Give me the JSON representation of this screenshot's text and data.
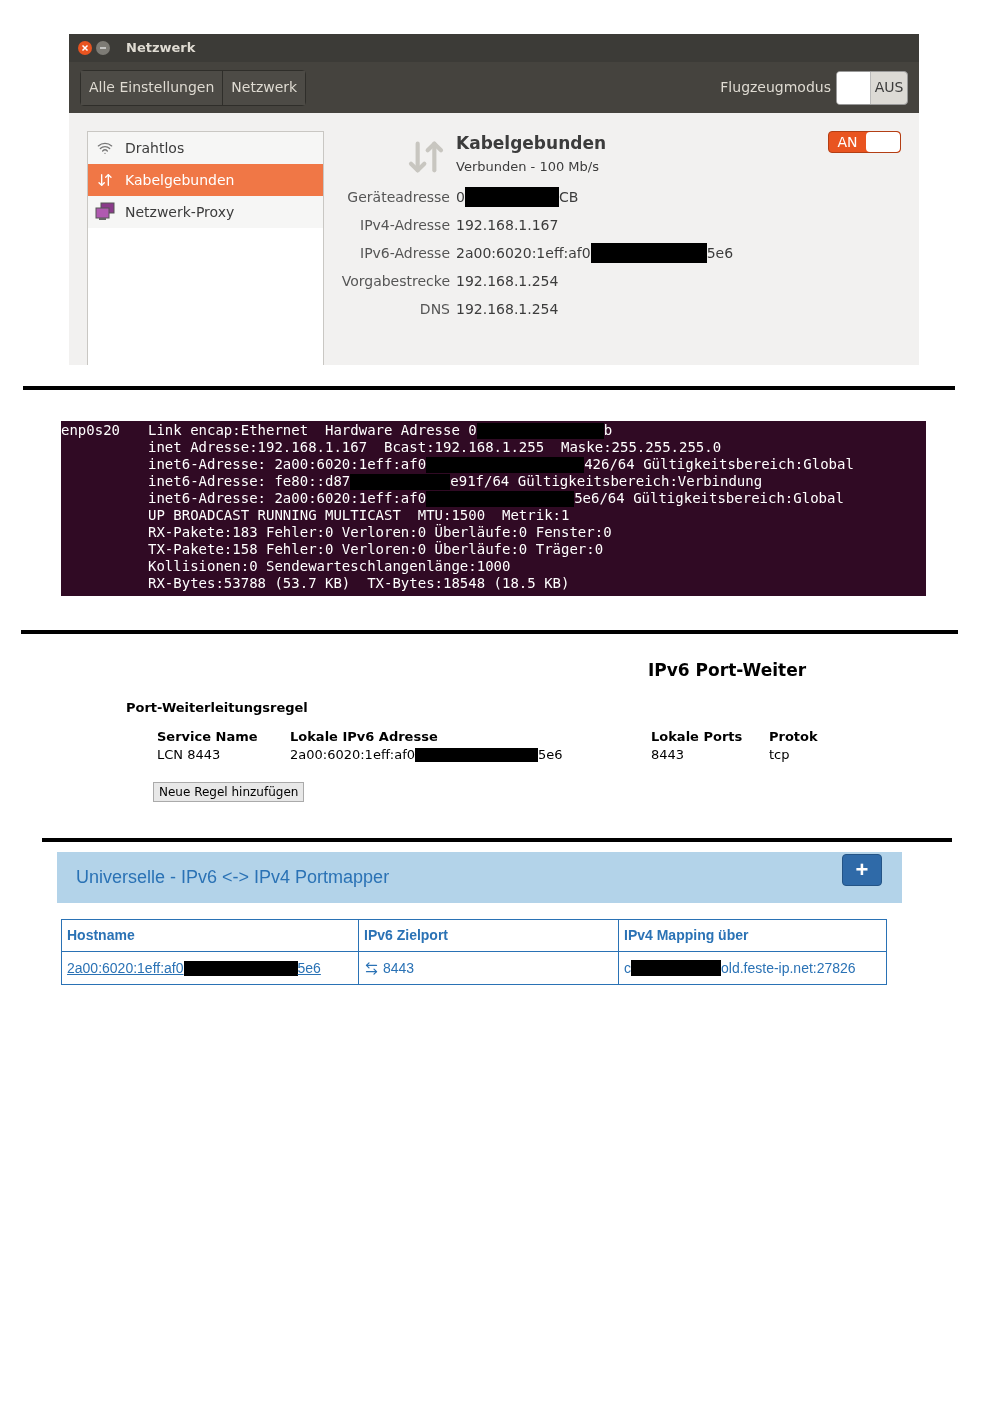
{
  "network_window": {
    "title": "Netzwerk",
    "breadcrumbs": [
      {
        "label": "Alle Einstellungen"
      },
      {
        "label": "Netzwerk"
      }
    ],
    "airplane_mode": {
      "label": "Flugzeugmodus",
      "state_text": "AUS",
      "on": false
    },
    "sidebar": {
      "items": [
        {
          "label": "Drahtlos",
          "kind": "wifi",
          "selected": false
        },
        {
          "label": "Kabelgebunden",
          "kind": "wired",
          "selected": true
        },
        {
          "label": "Netzwerk-Proxy",
          "kind": "proxy",
          "selected": false
        }
      ]
    },
    "connection": {
      "title": "Kabelgebunden",
      "status": "Verbunden - 100 Mb/s",
      "switch": {
        "state_text": "AN",
        "on": true
      },
      "details": [
        {
          "label": "Geräteadresse",
          "parts": [
            "0",
            "CB"
          ]
        },
        {
          "label": "IPv4-Adresse",
          "parts": [
            "192.168.1.167"
          ]
        },
        {
          "label": "IPv6-Adresse",
          "parts": [
            "2a00:6020:1eff:af0",
            "5e6"
          ]
        },
        {
          "label": "Vorgabestrecke",
          "parts": [
            "192.168.1.254"
          ]
        },
        {
          "label": "DNS",
          "parts": [
            "192.168.1.254"
          ]
        }
      ]
    }
  },
  "terminal": {
    "interface": "enp0s20",
    "lines": [
      {
        "parts": [
          "Link encap:Ethernet  Hardware Adresse 0",
          "b"
        ]
      },
      {
        "parts": [
          "inet Adresse:192.168.1.167  Bcast:192.168.1.255  Maske:255.255.255.0"
        ]
      },
      {
        "parts": [
          "inet6-Adresse: 2a00:6020:1eff:af0",
          "426/64 Gültigkeitsbereich:Global"
        ]
      },
      {
        "parts": [
          "inet6-Adresse: fe80::d87",
          "e91f/64 Gültigkeitsbereich:Verbindung"
        ]
      },
      {
        "parts": [
          "inet6-Adresse: 2a00:6020:1eff:af0",
          "5e6/64 Gültigkeitsbereich:Global"
        ]
      },
      {
        "parts": [
          "UP BROADCAST RUNNING MULTICAST  MTU:1500  Metrik:1"
        ]
      },
      {
        "parts": [
          "RX-Pakete:183 Fehler:0 Verloren:0 Überläufe:0 Fenster:0"
        ]
      },
      {
        "parts": [
          "TX-Pakete:158 Fehler:0 Verloren:0 Überläufe:0 Träger:0"
        ]
      },
      {
        "parts": [
          "Kollisionen:0 Sendewarteschlangenlänge:1000"
        ]
      },
      {
        "parts": [
          "RX-Bytes:53788 (53.7 KB)  TX-Bytes:18548 (18.5 KB)"
        ]
      }
    ]
  },
  "port_forwarding": {
    "title": "IPv6 Port-Weiter",
    "section_title": "Port-Weiterleitungsregel",
    "columns": [
      "Service Name",
      "Lokale IPv6 Adresse",
      "Lokale Ports",
      "Protok"
    ],
    "rows": [
      [
        {
          "parts": [
            "LCN 8443"
          ]
        },
        {
          "parts": [
            "2a00:6020:1eff:af0",
            "5e6"
          ]
        },
        {
          "parts": [
            "8443"
          ]
        },
        {
          "parts": [
            "tcp"
          ]
        }
      ]
    ],
    "add_button": "Neue Regel hinzufügen"
  },
  "portmapper": {
    "title": "Universelle - IPv6 <-> IPv4 Portmapper",
    "add_button": "+",
    "columns": [
      "Hostname",
      "IPv6 Zielport",
      "IPv4 Mapping über"
    ],
    "rows": [
      {
        "hostname": [
          "2a00:6020:1eff:af0",
          "5e6"
        ],
        "port": "8443",
        "mapping": [
          "c",
          "old.feste-ip.net:27826"
        ]
      }
    ]
  }
}
